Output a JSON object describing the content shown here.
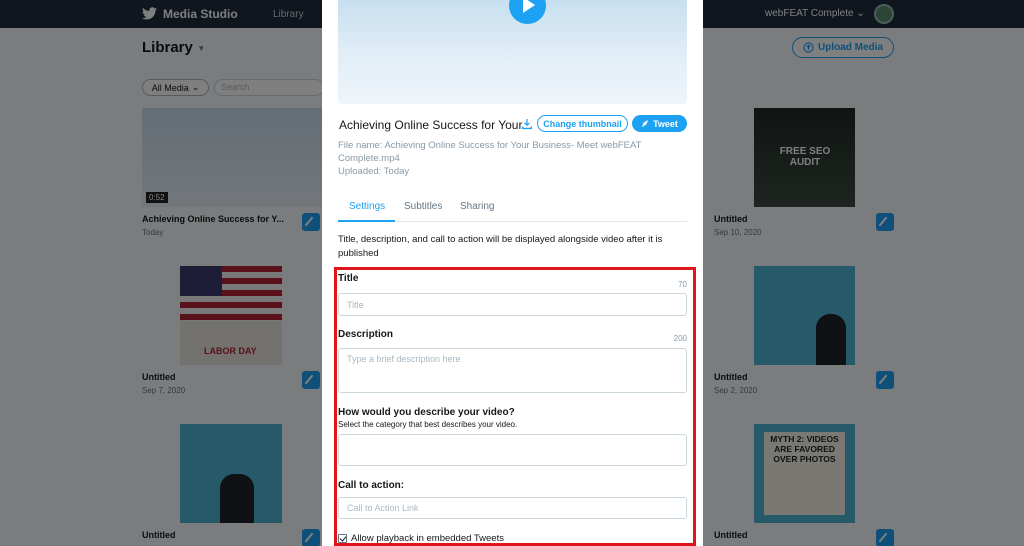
{
  "app": {
    "brand": "Media Studio",
    "nav_library": "Library",
    "account": "webFEAT Complete ⌄",
    "page_title": "Library",
    "upload_label": "Upload Media",
    "filter_label": "All Media",
    "search_placeholder": "Search"
  },
  "cards": [
    {
      "title": "Achieving Online Success for Y...",
      "date": "Today",
      "duration": "0:52"
    },
    {
      "title": "Untitled",
      "date": "Sep 10, 2020",
      "thumb_text": "FREE SEO AUDIT"
    },
    {
      "title": "Untitled",
      "date": "Sep 7, 2020",
      "thumb_text": "LABOR DAY"
    },
    {
      "title": "Untitled",
      "date": "Sep 2, 2020"
    },
    {
      "title": "Untitled",
      "date": ""
    },
    {
      "title": "Untitled",
      "date": "",
      "thumb_text": "MYTH 2: VIDEOS ARE FAVORED OVER PHOTOS"
    }
  ],
  "modal": {
    "video_title": "Achieving Online Success for Your...",
    "change_thumbnail": "Change thumbnail",
    "tweet": "Tweet",
    "file_name_line1": "File name: Achieving Online Success for Your Business- Meet webFEAT",
    "file_name_line2": "Complete.mp4",
    "uploaded": "Uploaded: Today",
    "tabs": [
      "Settings",
      "Subtitles",
      "Sharing"
    ],
    "help_text": "Title, description, and call to action will be displayed alongside video after it is published",
    "title_label": "Title",
    "title_counter": "70",
    "title_placeholder": "Title",
    "description_label": "Description",
    "description_counter": "200",
    "description_placeholder": "Type a brief description here",
    "category_label": "How would you describe your video?",
    "category_sub": "Select the category that best describes your video.",
    "cta_label": "Call to action:",
    "cta_placeholder": "Call to Action Link",
    "allow_playback": "Allow playback in embedded Tweets"
  },
  "colors": {
    "accent": "#1da1f2",
    "highlight": "#e0141c",
    "topbar": "#1f2d3a"
  }
}
